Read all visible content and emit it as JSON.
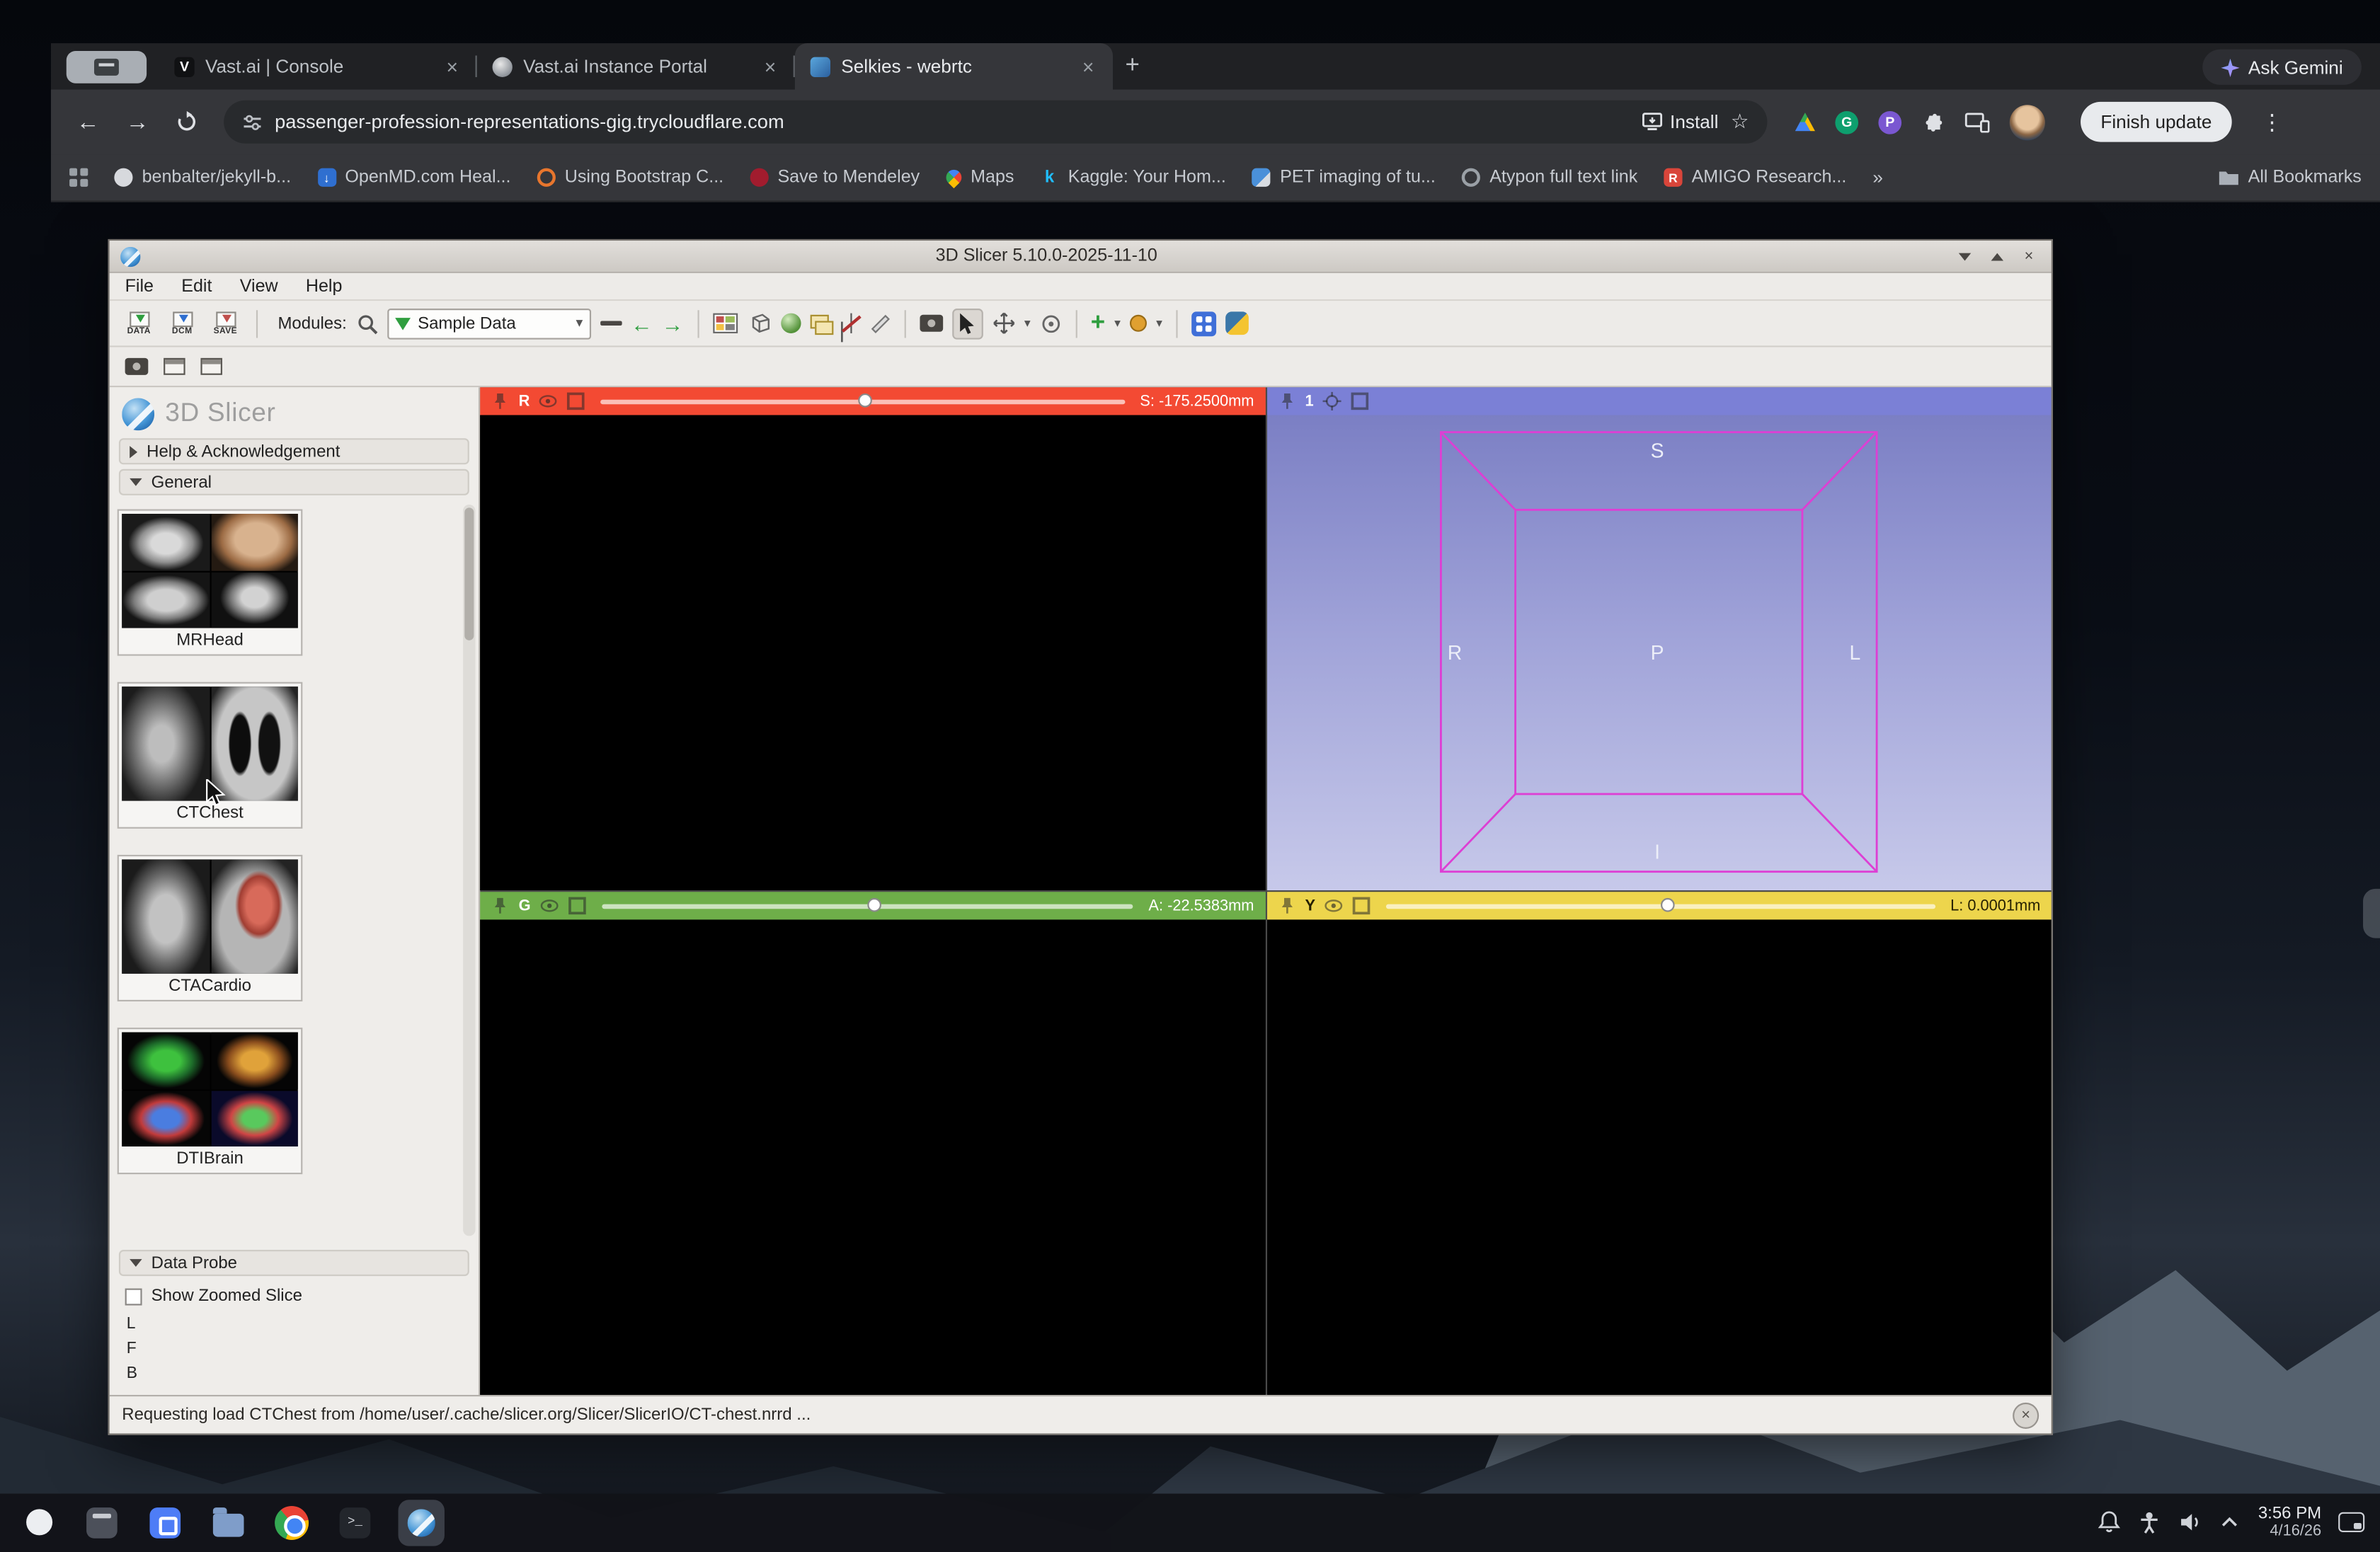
{
  "browser": {
    "tabs": [
      {
        "label": "Vast.ai | Console"
      },
      {
        "label": "Vast.ai Instance Portal"
      },
      {
        "label": "Selkies - webrtc"
      }
    ],
    "ask_gemini_label": "Ask Gemini",
    "url": "passenger-profession-representations-gig.trycloudflare.com",
    "install_label": "Install",
    "finish_update_label": "Finish update",
    "bookmarks": [
      "benbalter/jekyll-b...",
      "OpenMD.com Heal...",
      "Using Bootstrap C...",
      "Save to Mendeley",
      "Maps",
      "Kaggle: Your Hom...",
      "PET imaging of tu...",
      "Atypon full text link",
      "AMIGO Research..."
    ],
    "bookmarks_overflow": "»",
    "all_bookmarks_label": "All Bookmarks"
  },
  "slicer": {
    "window_title": "3D Slicer 5.10.0-2025-11-10",
    "menu": {
      "file": "File",
      "edit": "Edit",
      "view": "View",
      "help": "Help"
    },
    "toolbar": {
      "data_caption": "DATA",
      "dcm_caption": "DCM",
      "save_caption": "SAVE",
      "modules_label": "Modules:",
      "selected_module": "Sample Data"
    },
    "panel": {
      "logo_text": "3D Slicer",
      "help_section": "Help & Acknowledgement",
      "general_section": "General",
      "samples": [
        "MRHead",
        "CTChest",
        "CTACardio",
        "DTIBrain"
      ],
      "data_probe_title": "Data Probe",
      "show_zoomed_label": "Show Zoomed Slice",
      "probe_rows": [
        "L",
        "F",
        "B"
      ]
    },
    "views": {
      "red": {
        "letter": "R",
        "value": "S: -175.2500mm"
      },
      "green": {
        "letter": "G",
        "value": "A: -22.5383mm"
      },
      "yellow": {
        "letter": "Y",
        "value": "L: 0.0001mm"
      },
      "threed": {
        "label": "1",
        "axis_s": "S",
        "axis_r": "R",
        "axis_p": "P",
        "axis_l": "L",
        "axis_i": "I"
      }
    },
    "status_message": "Requesting load CTChest from /home/user/.cache/slicer.org/Slicer/SlicerIO/CT-chest.nrrd ..."
  },
  "shelf": {
    "time": "3:56 PM",
    "date": "4/16/26"
  },
  "colors": {
    "red_slice": "#f34a33",
    "green_slice": "#6eae49",
    "yellow_slice": "#edd54c",
    "threed_header": "#7b80d6",
    "bbox_magenta": "#dd3fd4"
  }
}
